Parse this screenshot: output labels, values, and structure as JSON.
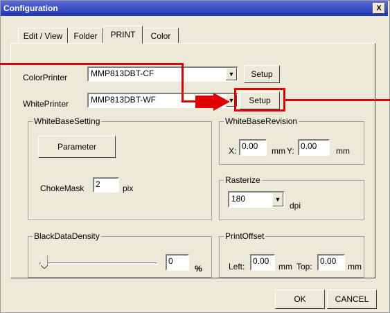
{
  "window": {
    "title": "Configuration",
    "close_label": "X"
  },
  "tabs": [
    {
      "label": "Edit / View"
    },
    {
      "label": "Folder"
    },
    {
      "label": "PRINT",
      "active": true
    },
    {
      "label": "Color"
    }
  ],
  "printers": {
    "color_label": "ColorPrinter",
    "color_value": "MMP813DBT-CF",
    "white_label": "WhitePrinter",
    "white_value": "MMP813DBT-WF",
    "setup_label": "Setup"
  },
  "white_base_setting": {
    "title": "WhiteBaseSetting",
    "parameter_label": "Parameter",
    "choke_label": "ChokeMask",
    "choke_value": "2",
    "choke_unit": "pix"
  },
  "white_base_revision": {
    "title": "WhiteBaseRevision",
    "x_label": "X:",
    "x_value": "0.00",
    "y_label": "Y:",
    "y_value": "0.00",
    "unit": "mm"
  },
  "rasterize": {
    "title": "Rasterize",
    "value": "180",
    "unit": "dpi"
  },
  "black_data_density": {
    "title": "BlackDataDensity",
    "value": "0",
    "unit": "%",
    "slider_level": 0
  },
  "print_offset": {
    "title": "PrintOffset",
    "left_label": "Left:",
    "left_value": "0.00",
    "top_label": "Top:",
    "top_value": "0.00",
    "unit": "mm"
  },
  "footer": {
    "ok_label": "OK",
    "cancel_label": "CANCEL"
  },
  "colors": {
    "annotation": "#e00000",
    "dialog_bg": "#ece9d8",
    "titlebar": "#2a3fbf"
  }
}
